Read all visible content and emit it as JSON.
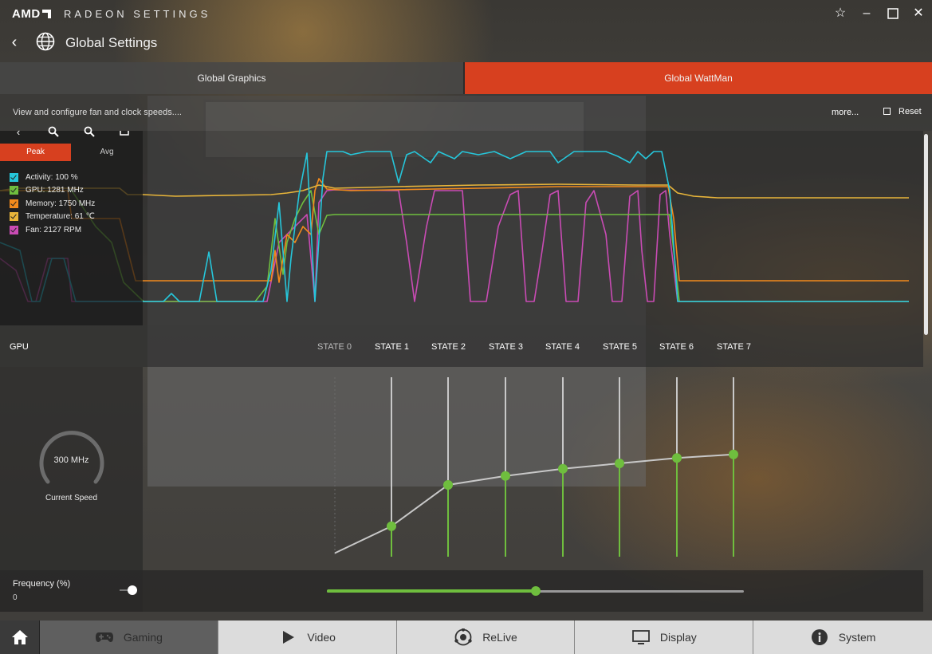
{
  "app": {
    "brand": "AMD",
    "title": "RADEON SETTINGS"
  },
  "header": {
    "title": "Global Settings"
  },
  "tabs": [
    {
      "label": "Global Graphics",
      "active": false
    },
    {
      "label": "Global WattMan",
      "active": true
    }
  ],
  "description": {
    "text": "View and configure fan and clock speeds....",
    "more_label": "more...",
    "reset_label": "Reset"
  },
  "monitor": {
    "peak_label": "Peak",
    "avg_label": "Avg",
    "legend": [
      {
        "label": "Activity: 100 %",
        "color": "#26c6da"
      },
      {
        "label": "GPU: 1281 MHz",
        "color": "#6fbe3e"
      },
      {
        "label": "Memory: 1750 MHz",
        "color": "#f28a1c"
      },
      {
        "label": "Temperature: 61 ℃",
        "color": "#e8b53a"
      },
      {
        "label": "Fan: 2127 RPM",
        "color": "#c94bb4"
      }
    ]
  },
  "gpu": {
    "section_label": "GPU",
    "states": [
      "STATE 0",
      "STATE 1",
      "STATE 2",
      "STATE 3",
      "STATE 4",
      "STATE 5",
      "STATE 6",
      "STATE 7"
    ],
    "state_levels": [
      0.02,
      0.17,
      0.4,
      0.45,
      0.49,
      0.52,
      0.55,
      0.57
    ],
    "current_speed_value": "300 MHz",
    "current_speed_label": "Current Speed"
  },
  "frequency": {
    "label": "Frequency (%)",
    "value": "0",
    "slider_position": 0.5
  },
  "nav": [
    {
      "label": "Gaming",
      "icon": "gamepad-icon",
      "style": "dark"
    },
    {
      "label": "Video",
      "icon": "play-icon",
      "style": "light"
    },
    {
      "label": "ReLive",
      "icon": "relive-icon",
      "style": "light"
    },
    {
      "label": "Display",
      "icon": "monitor-icon",
      "style": "light"
    },
    {
      "label": "System",
      "icon": "info-icon",
      "style": "light"
    }
  ],
  "colors": {
    "accent": "#d7401f",
    "green": "#6fbe3e"
  }
}
